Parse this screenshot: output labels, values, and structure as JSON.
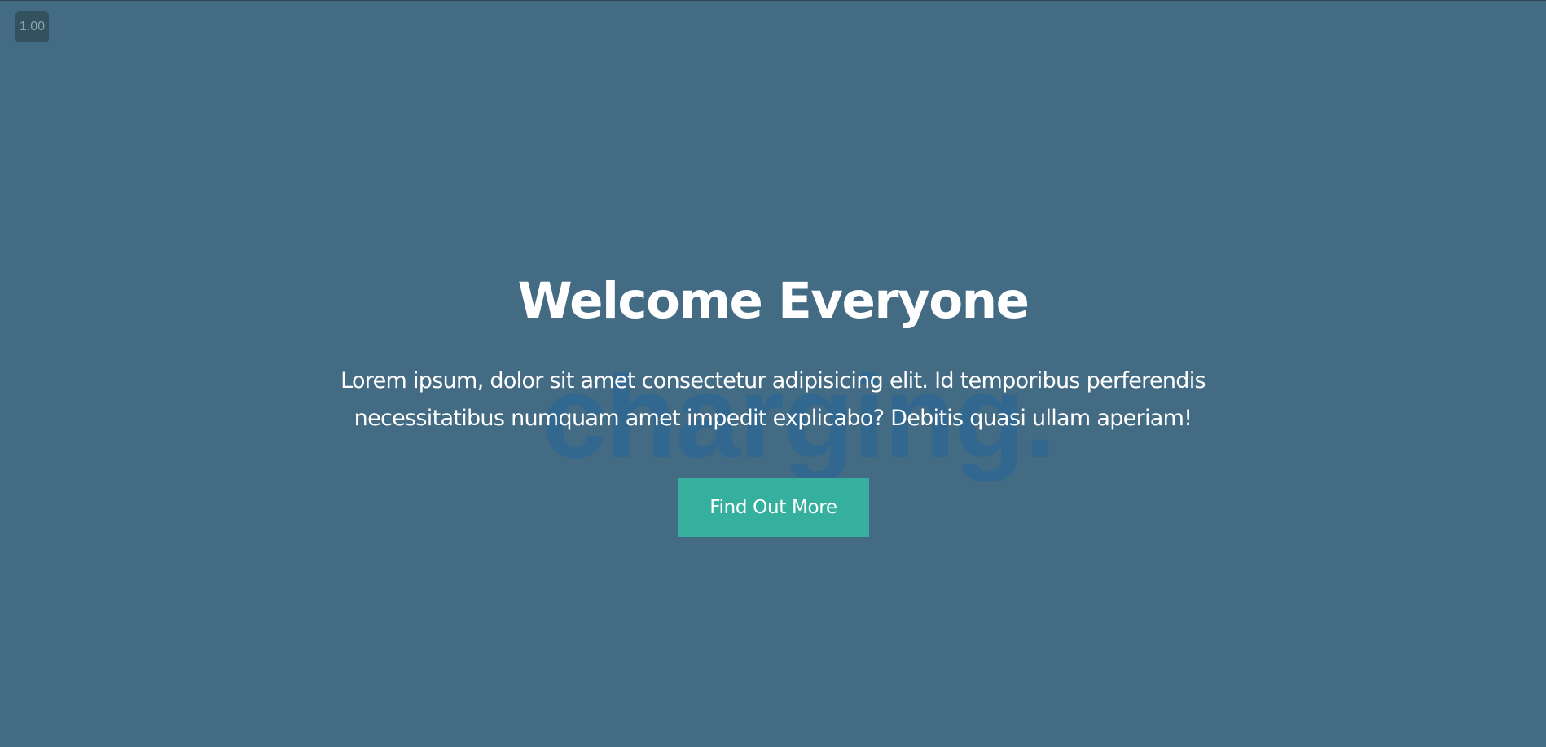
{
  "zoom_badge": {
    "label": "1.00"
  },
  "watermark": {
    "text": "charging."
  },
  "hero": {
    "title": "Welcome Everyone",
    "text": "Lorem ipsum, dolor sit amet consectetur adipisicing elit. Id temporibus perferendis necessitatibus numquam amet impedit explicabo? Debitis quasi ullam aperiam!",
    "button_label": "Find Out More"
  },
  "colors": {
    "background": "#436b84",
    "accent": "#35b09f",
    "text": "#ffffff"
  }
}
